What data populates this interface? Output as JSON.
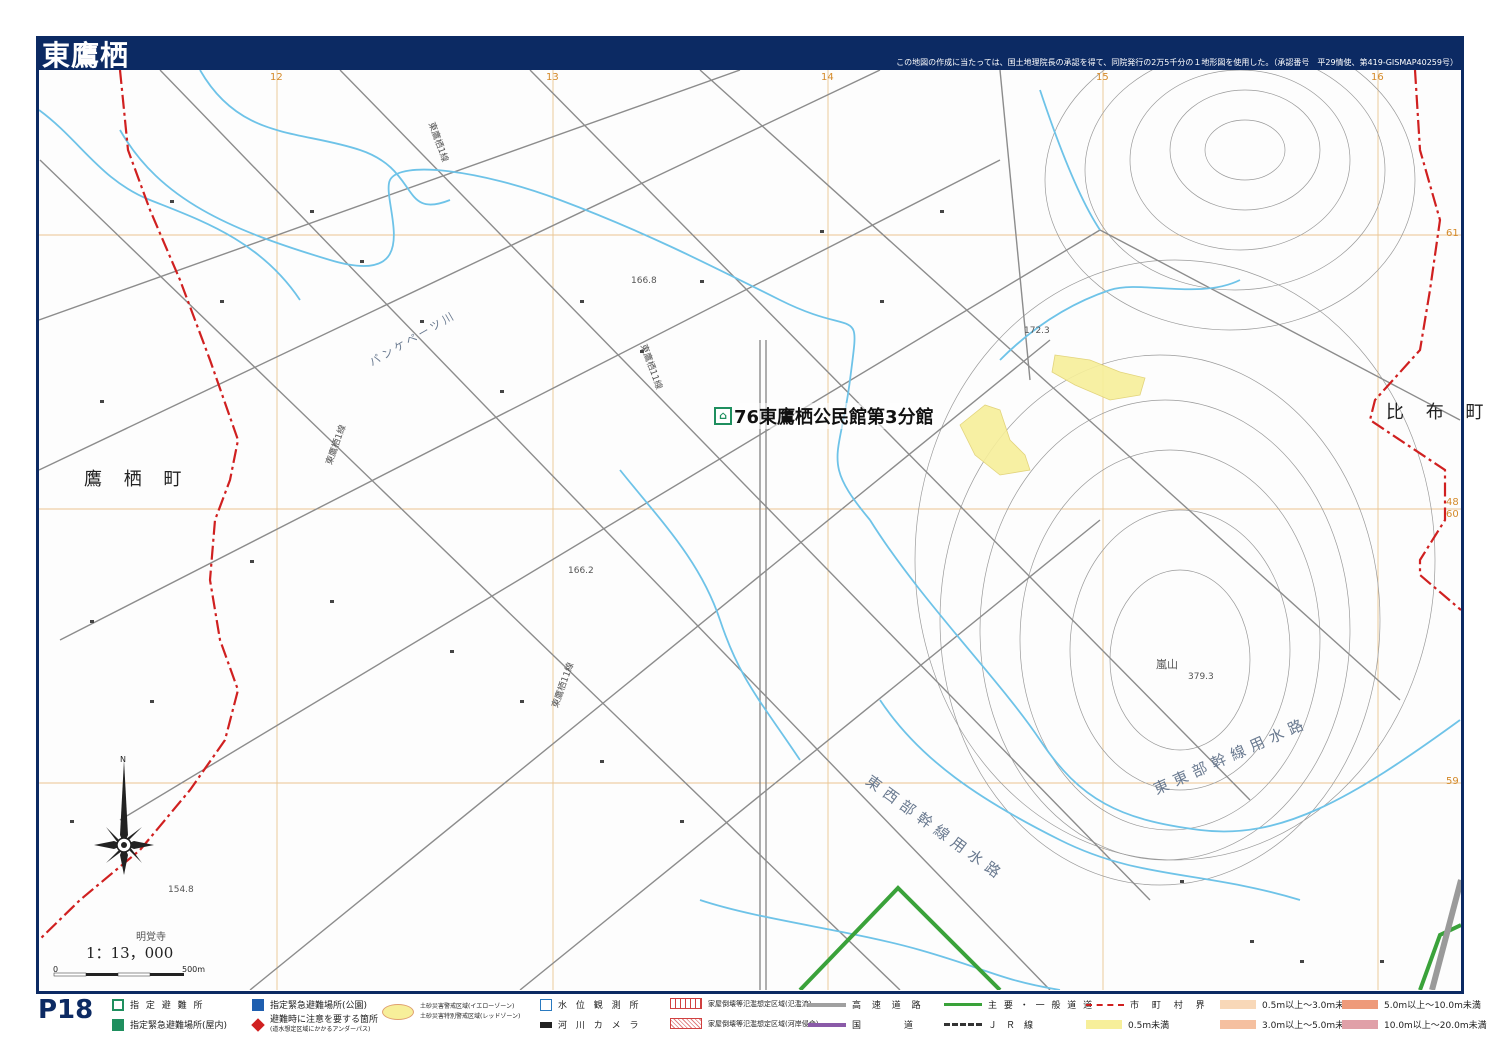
{
  "header": {
    "title": "東鷹栖",
    "credit": "この地図の作成に当たっては、国土地理院長の承認を得て、同院発行の2万5千分の１地形図を使用した。（承認番号　平29情使、第419-GISMAP40259号）"
  },
  "map": {
    "town_labels": {
      "left": "鷹 栖 町",
      "right": "比 布 町"
    },
    "shelter_label": "76東鷹栖公民館第3分館",
    "scale_text": "1：13，000",
    "scale_zero": "0",
    "scale_end": "500m",
    "elevations": [
      "166.8",
      "172.3",
      "166.2",
      "154.8",
      "379.3"
    ],
    "mountain_name": "嵐山",
    "road_labels": [
      "東鷹栖1線",
      "東鷹栖11線",
      "東鷹栖1線",
      "東鷹栖11線"
    ],
    "river_label": "パンケペーツ川",
    "temple_label": "明覚寺",
    "canal_west": "東西部幹線用水路",
    "canal_east": "東東部幹線用水路",
    "grid_top": [
      "12",
      "13",
      "14",
      "15",
      "16"
    ],
    "grid_right": [
      "61",
      "60",
      "59"
    ],
    "grid_right_pair": [
      "48",
      "60"
    ],
    "compass_label": "N"
  },
  "footer": {
    "page_number": "P18",
    "legend": {
      "designated_shelter": "指 定 避 難 所",
      "emergency_site_park": "指定緊急避難場所(公園)",
      "emergency_site_indoor": "指定緊急避難場所(屋内)",
      "caution_point": "避難時に注意を要する箇所",
      "caution_point_sub": "(道水想定区域にかかるアンダーパス)",
      "landslide_yellow": "土砂災害警戒区域(イエローゾーン)",
      "landslide_red": "土砂災害特別警戒区域(レッドゾーン)",
      "water_station": "水 位 観 測 所",
      "river_camera": "河 川 カ メ ラ",
      "collapse_flood": "家屋倒壊等氾濫想定区域(氾濫流)",
      "collapse_erosion": "家屋倒壊等氾濫想定区域(河岸侵食)",
      "expressway": "高 速 道 路",
      "national_road": "国　　　道",
      "main_road": "主 要 ・ 一 般 道 道",
      "jr_line": "Ｊ　Ｒ　線",
      "municipal_border": "市 町 村 界",
      "depth_0": "0.5m未満",
      "depth_1": "0.5m以上～3.0m未満",
      "depth_2": "3.0m以上～5.0m未満",
      "depth_3": "5.0m以上～10.0m未満",
      "depth_4": "10.0m以上～20.0m未満"
    }
  },
  "colors": {
    "frame": "#0c2a63",
    "river": "#6ec3e8",
    "road": "#8a8a8a",
    "border": "#d02020",
    "main_road": "#3aa23a",
    "hazard_yellow": "#f7ef9a",
    "grid": "#e2b070",
    "shelter_green": "#1f8f5f"
  }
}
